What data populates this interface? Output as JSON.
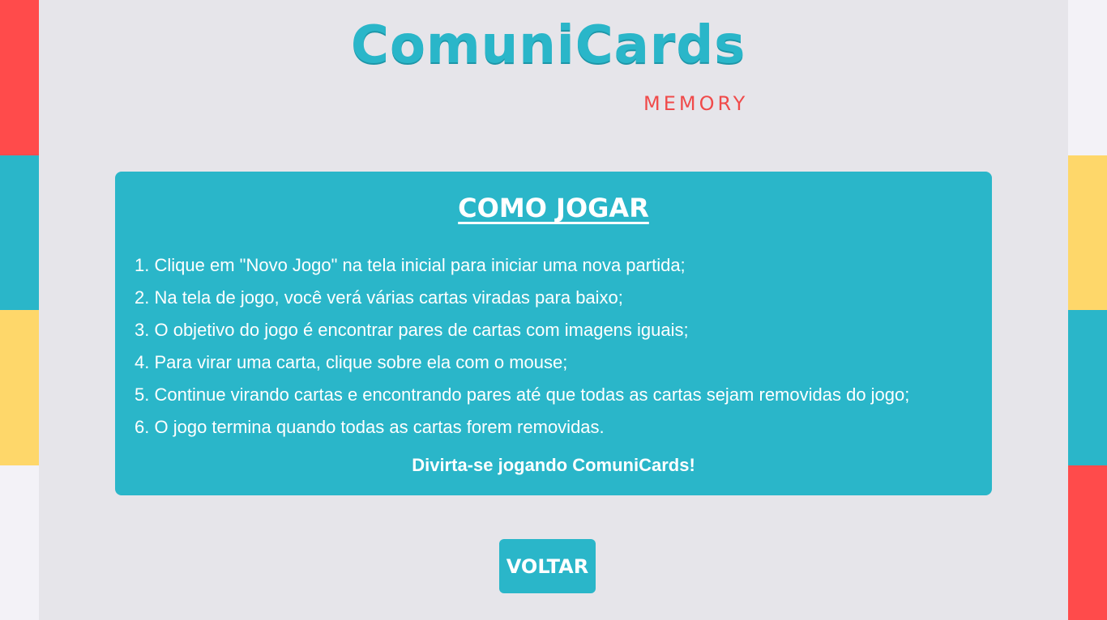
{
  "logo": {
    "title": "ComuniCards",
    "subtitle": "MEMORY"
  },
  "panel": {
    "title": "COMO JOGAR",
    "steps": [
      {
        "number": "1.",
        "text": "Clique em \"Novo Jogo\" na tela inicial para iniciar uma nova partida;"
      },
      {
        "number": "2.",
        "text": "Na tela de jogo, você verá várias cartas viradas para baixo;"
      },
      {
        "number": "3.",
        "text": "O objetivo do jogo é encontrar pares de cartas com imagens iguais;"
      },
      {
        "number": "4.",
        "text": "Para virar uma carta, clique sobre ela com o mouse;"
      },
      {
        "number": "5.",
        "text": "Continue virando cartas e encontrando pares até que todas as cartas sejam removidas do jogo;"
      },
      {
        "number": "6.",
        "text": "O jogo termina quando todas as cartas forem removidas."
      }
    ],
    "footer": "Divirta-se jogando ComuniCards!"
  },
  "back_button": {
    "label": "VOLTAR"
  },
  "colors": {
    "accent": "#2ab6c9",
    "red": "#ff4b4b",
    "yellow": "#fed76a",
    "light": "#f3f2f7",
    "background": "#e6e5ea"
  },
  "side_strips": {
    "left": [
      "#ff4b4b",
      "#2ab6c9",
      "#fed76a",
      "#f3f2f7"
    ],
    "right": [
      "#f3f2f7",
      "#fed76a",
      "#2ab6c9",
      "#ff4b4b"
    ]
  }
}
